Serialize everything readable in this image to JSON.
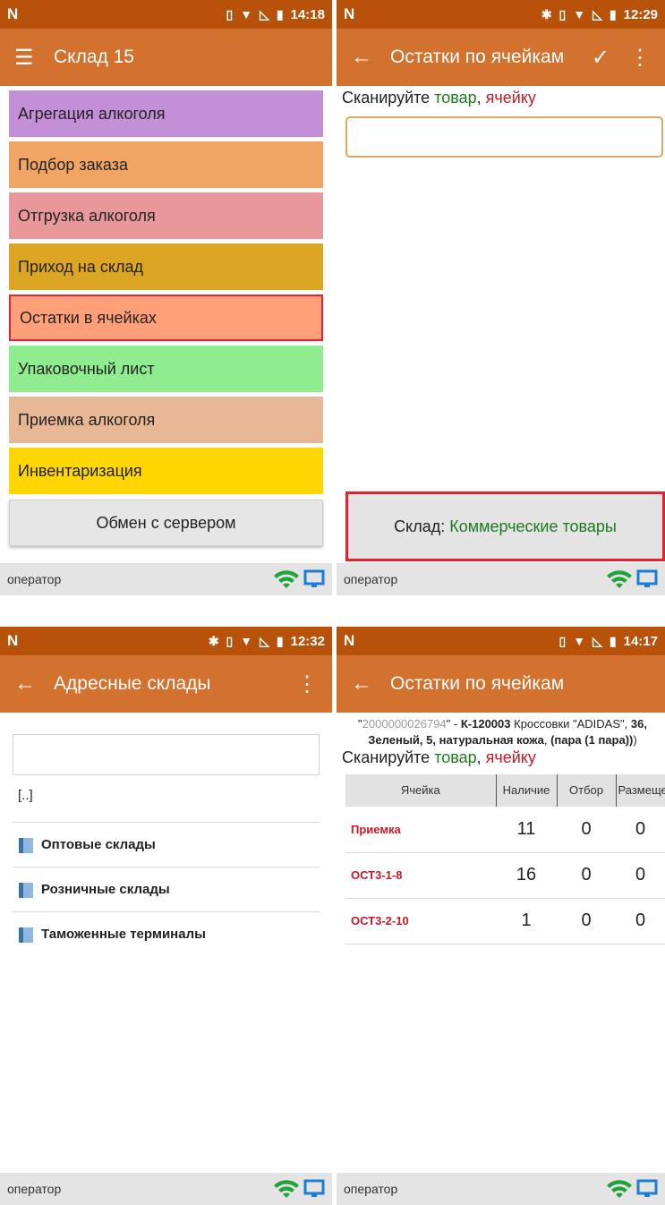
{
  "common": {
    "operator_label": "оператор",
    "brand_glyph": "N",
    "colors": {
      "statusbar": "#b8520a",
      "appbar": "#d2722e",
      "wifi": "#21a33c",
      "monitor": "#1a7fd4"
    }
  },
  "screen1": {
    "time": "14:18",
    "title": "Склад 15",
    "menu": [
      {
        "label": "Агрегация алкоголя",
        "color": "#c38fd6"
      },
      {
        "label": "Подбор заказа",
        "color": "#f2a464"
      },
      {
        "label": "Отгрузка алкоголя",
        "color": "#e8979a"
      },
      {
        "label": "Приход на склад",
        "color": "#dca524"
      },
      {
        "label": "Остатки в ячейках",
        "color": "#ffa07a"
      },
      {
        "label": "Упаковочный лист",
        "color": "#8fec8f"
      },
      {
        "label": "Приемка алкоголя",
        "color": "#e8b896"
      },
      {
        "label": "Инвентаризация",
        "color": "#ffd700"
      }
    ],
    "exchange_button": "Обмен с сервером"
  },
  "screen2": {
    "time": "12:29",
    "title": "Остатки по ячейкам",
    "prompt_prefix": "Сканируйте ",
    "prompt_goods": "товар",
    "prompt_sep": ", ",
    "prompt_cell": "ячейку",
    "warehouse_prefix": "Склад: ",
    "warehouse_value": "Коммерческие товары"
  },
  "screen3": {
    "time": "12:32",
    "title": "Адресные склады",
    "up_item": "[..]",
    "folders": [
      "Оптовые склады",
      "Розничные склады",
      "Таможенные терминалы"
    ]
  },
  "screen4": {
    "time": "14:17",
    "title": "Остатки по ячейкам",
    "barcode": "2000000026794",
    "article": "К-120003",
    "product_name": "Кроссовки \"ADIDAS\",",
    "product_attrs": "36, Зеленый, 5, натуральная кожа",
    "pack": "(пара (1 пара))",
    "prompt_prefix": "Сканируйте ",
    "prompt_goods": "товар",
    "prompt_sep": ", ",
    "prompt_cell": "ячейку",
    "columns": [
      "Ячейка",
      "Наличие",
      "Отбор",
      "Размещение"
    ],
    "rows": [
      {
        "cell": "Приемка",
        "qty": "11",
        "pick": "0",
        "place": "0"
      },
      {
        "cell": "ОСТ3-1-8",
        "qty": "16",
        "pick": "0",
        "place": "0"
      },
      {
        "cell": "ОСТ3-2-10",
        "qty": "1",
        "pick": "0",
        "place": "0"
      }
    ]
  }
}
